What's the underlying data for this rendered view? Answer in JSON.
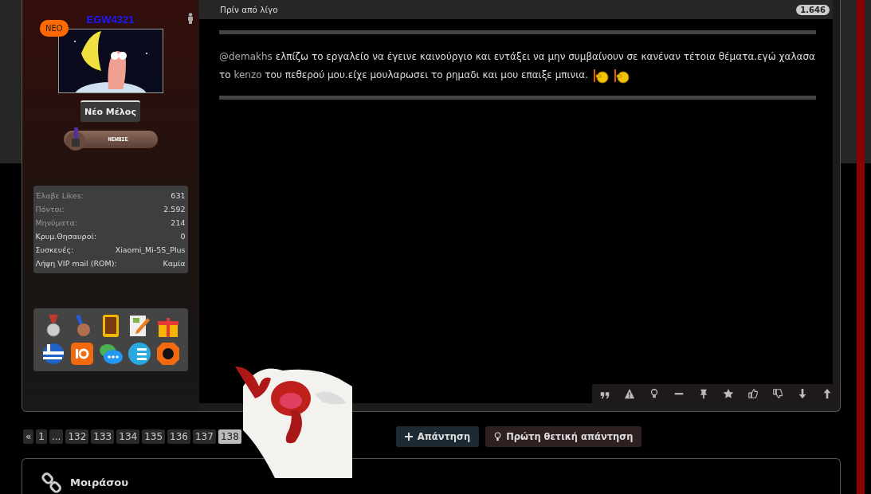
{
  "user": {
    "badge": "ΝΕΟ",
    "name": "EGW4321",
    "rank": "Νέο Μέλος",
    "level_label": "NEWBIE",
    "stats": [
      {
        "label": "Έλαβε Likes:",
        "value": "631",
        "dim": true
      },
      {
        "label": "Πόντοι:",
        "value": "2.592",
        "dim": true
      },
      {
        "label": "Μηνύματα:",
        "value": "214",
        "dim": true
      },
      {
        "label": "Κρυμ.Θησαυροί:",
        "value": "0",
        "dim": false
      },
      {
        "label": "Συσκευές:",
        "value": "Xiaomi_Mi-5S_Plus",
        "dim": false
      },
      {
        "label": "Λήψη VIP mail (ROM):",
        "value": "Καμία",
        "dim": false
      }
    ]
  },
  "post": {
    "time": "Πρίν από λίγο",
    "count": "1.646",
    "segments": [
      {
        "kind": "mention",
        "text": "@demakhs"
      },
      {
        "kind": "text",
        "text": " ελπίζω το εργαλείο να έγεινε καινούργιο και εντάξει να μην συμβαίνουν σε κανέναν τέτοια θέματα.εγώ χαλασα το "
      },
      {
        "kind": "link",
        "text": "kenzo"
      },
      {
        "kind": "text",
        "text": " του πεθερού μου.είχε μουλαρωσει το ρημαδι και μου επαιξε μπινια."
      }
    ]
  },
  "pagination": [
    {
      "label": "«",
      "selected": false
    },
    {
      "label": "1",
      "selected": false
    },
    {
      "label": "...",
      "selected": false
    },
    {
      "label": "132",
      "selected": false
    },
    {
      "label": "133",
      "selected": false
    },
    {
      "label": "134",
      "selected": false
    },
    {
      "label": "135",
      "selected": false
    },
    {
      "label": "136",
      "selected": false
    },
    {
      "label": "137",
      "selected": false
    },
    {
      "label": "138",
      "selected": true
    }
  ],
  "buttons": [
    {
      "kind": "reply",
      "label": "Απάντηση"
    },
    {
      "kind": "first",
      "label": "Πρώτη θετική απάντηση"
    }
  ],
  "share": {
    "title": "Μοιράσου"
  }
}
